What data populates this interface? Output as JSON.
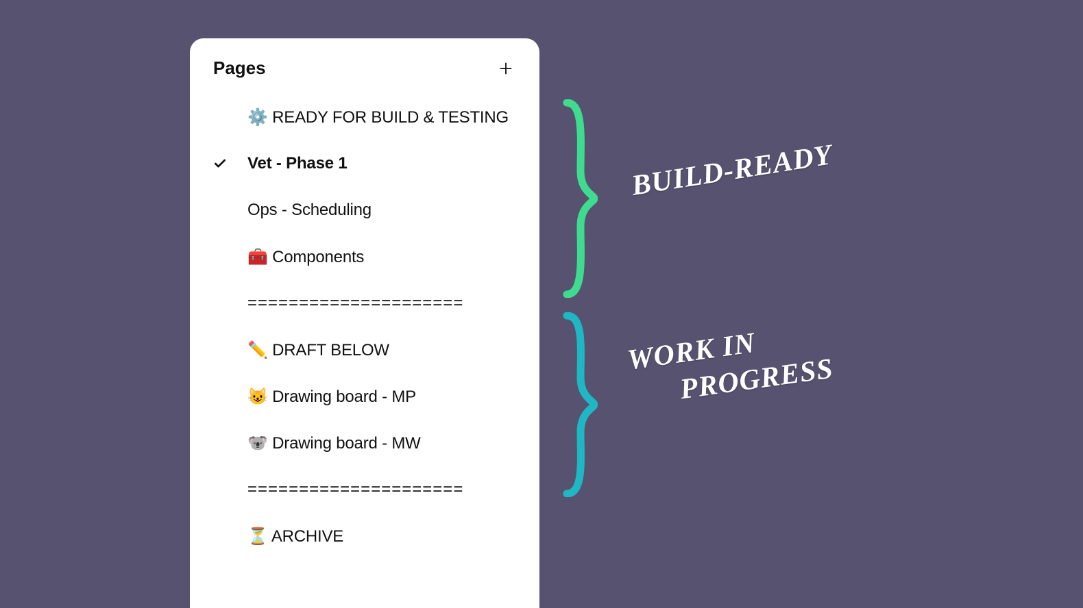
{
  "panel": {
    "title": "Pages",
    "plus_title": "Add page"
  },
  "pages": [
    {
      "label": "⚙️ READY FOR BUILD & TESTING",
      "selected": false,
      "icon_name": "gear-icon"
    },
    {
      "label": "Vet - Phase 1",
      "selected": true,
      "icon_name": ""
    },
    {
      "label": "Ops - Scheduling",
      "selected": false,
      "icon_name": ""
    },
    {
      "label": "🧰 Components",
      "selected": false,
      "icon_name": "toolbox-icon"
    },
    {
      "label": "=====================",
      "selected": false,
      "divider": true,
      "icon_name": ""
    },
    {
      "label": "✏️ DRAFT BELOW",
      "selected": false,
      "icon_name": "pencil-icon"
    },
    {
      "label": "😺 Drawing board - MP",
      "selected": false,
      "icon_name": "cat-icon"
    },
    {
      "label": "🐨 Drawing board - MW",
      "selected": false,
      "icon_name": "koala-icon"
    },
    {
      "label": "=====================",
      "selected": false,
      "divider": true,
      "icon_name": ""
    },
    {
      "label": "⏳ ARCHIVE",
      "selected": false,
      "icon_name": "hourglass-icon"
    }
  ],
  "annotations": {
    "build_ready": "BUILD-READY",
    "wip_line1": "WORK IN",
    "wip_line2": "PROGRESS"
  },
  "colors": {
    "brace_green": "#3FDC8F",
    "brace_teal": "#1FB7C3"
  }
}
